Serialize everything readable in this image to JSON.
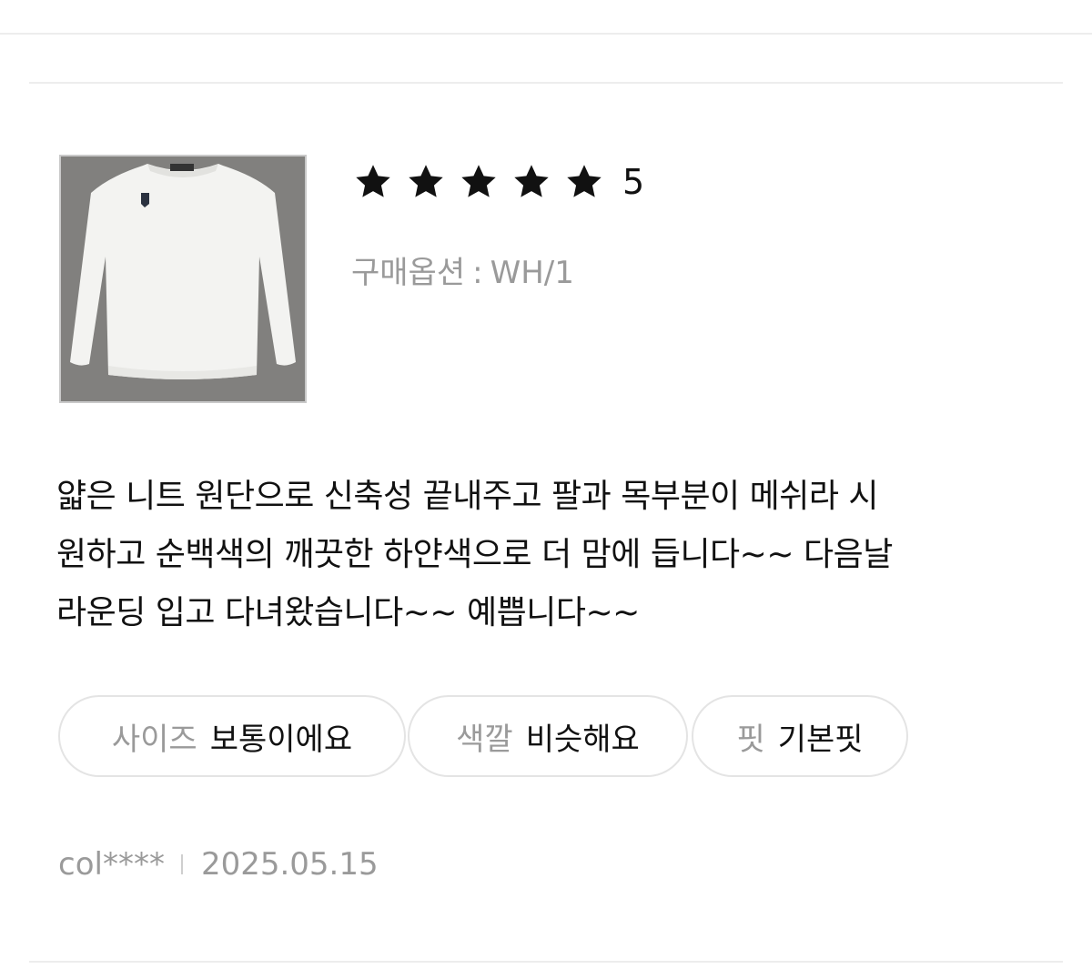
{
  "review": {
    "rating": {
      "stars": 5,
      "max_stars": 5,
      "score_text": "5",
      "star_color": "#111111"
    },
    "option": {
      "label": "구매옵션",
      "separator": ":",
      "value": "WH/1"
    },
    "body_lines": [
      "얇은 니트 원단으로 신축성 끝내주고 팔과 목부분이 메쉬라 시",
      "원하고 순백색의 깨끗한 하얀색으로 더 맘에 듭니다~~ 다음날",
      "라운딩 입고 다녀왔습니다~~ 예쁩니다~~"
    ],
    "tags": [
      {
        "key": "사이즈",
        "value": "보통이에요"
      },
      {
        "key": "색깔",
        "value": "비슷해요"
      },
      {
        "key": "핏",
        "value": "기본핏"
      }
    ],
    "author": "col****",
    "date": "2025.05.15"
  },
  "colors": {
    "text_primary": "#111111",
    "text_secondary": "#9a9a9a",
    "border": "#e4e4e4",
    "divider": "#ededed"
  }
}
